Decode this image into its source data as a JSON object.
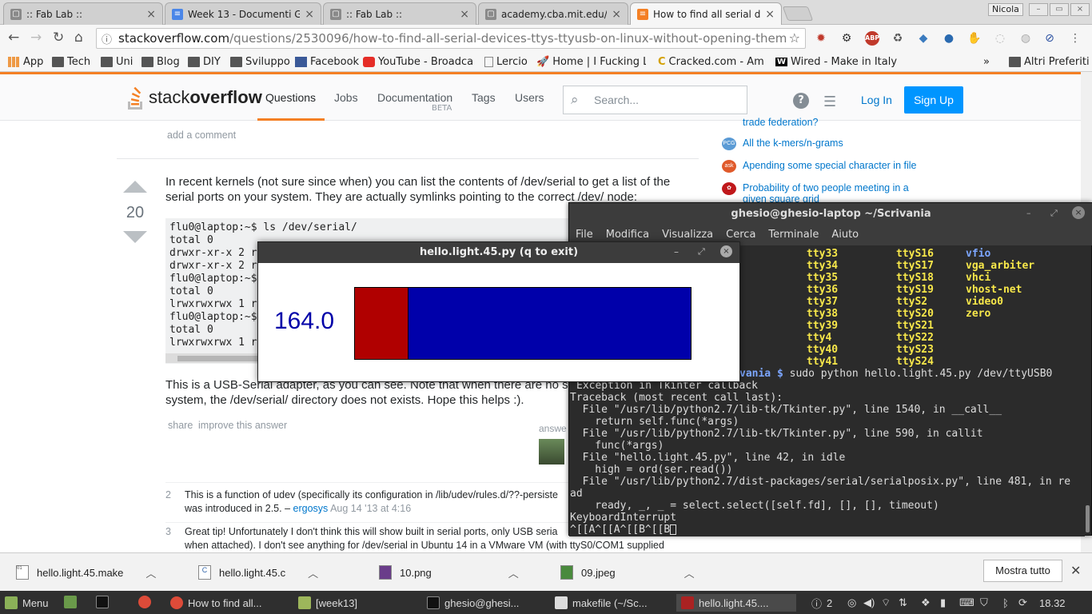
{
  "browser": {
    "tabs": [
      {
        "title": ":: Fab Lab ::",
        "icon_color": "#8a8a8a"
      },
      {
        "title": "Week 13 - Documenti G",
        "icon_color": "#4a86e8"
      },
      {
        "title": ":: Fab Lab ::",
        "icon_color": "#8a8a8a"
      },
      {
        "title": "academy.cba.mit.edu/cl",
        "icon_color": "#8a8a8a"
      },
      {
        "title": "How to find all serial de",
        "icon_color": "#f48024"
      }
    ],
    "user": "Nicola",
    "url_host": "stackoverflow.com",
    "url_path": "/questions/2530096/how-to-find-all-serial-devices-ttys-ttyusb-on-linux-without-opening-them",
    "bookmarks": [
      {
        "label": "App",
        "icon": "apps-icon"
      },
      {
        "label": "Tech",
        "icon": "folder-icon"
      },
      {
        "label": "Uni",
        "icon": "folder-icon"
      },
      {
        "label": "Blog",
        "icon": "folder-icon"
      },
      {
        "label": "DIY",
        "icon": "folder-icon"
      },
      {
        "label": "Sviluppo",
        "icon": "folder-icon"
      },
      {
        "label": "Facebook",
        "icon": "facebook-icon"
      },
      {
        "label": "YouTube - Broadcast",
        "icon": "youtube-icon"
      },
      {
        "label": "Lercio",
        "icon": "page-icon"
      },
      {
        "label": "Home | I Fucking Lo",
        "icon": "rocket-icon"
      },
      {
        "label": "Cracked.com - Amer",
        "icon": "cracked-icon"
      },
      {
        "label": "Wired - Make in Italy",
        "icon": "wired-icon"
      }
    ],
    "bookmarks_more": "»",
    "other_bookmarks": "Altri Preferiti"
  },
  "so": {
    "logo_light": "stack",
    "logo_bold": "overflow",
    "nav": [
      "Questions",
      "Jobs",
      "Documentation",
      "Tags",
      "Users"
    ],
    "beta": "BETA",
    "search_placeholder": "Search...",
    "login": "Log In",
    "signup": "Sign Up",
    "add_comment": "add a comment",
    "sidebar": [
      {
        "text": "trade federation?",
        "icon_color": "#7a4fa8"
      },
      {
        "text": "All the k-mers/n-grams",
        "icon_color": "#5b9bd5"
      },
      {
        "text": "Apending some special character in file",
        "icon_color": "#e05a2b"
      },
      {
        "text": "Probability of two people meeting in a given square grid",
        "icon_color": "#c0181b"
      }
    ],
    "votes": "20",
    "answer_p1": "In recent kernels (not sure since when) you can list the contents of /dev/serial to get a list of the serial ports on your system. They are actually symlinks pointing to the correct /dev/ node:",
    "code_lines": [
      "flu0@laptop:~$ ls /dev/serial/",
      "total 0",
      "drwxr-xr-x 2 r",
      "drwxr-xr-x 2 r",
      "flu0@laptop:~$",
      "total 0",
      "lrwxrwxrwx 1 r",
      "flu0@laptop:~$",
      "total 0",
      "lrwxrwxrwx 1 r"
    ],
    "answer_p2": "This is a USB-Serial adapter, as you can see. Note that when there are no s",
    "answer_p3": "system, the /dev/serial/ directory does not exists. Hope this helps :).",
    "share": "share",
    "improve": "improve this answer",
    "answered": "answe",
    "comments": [
      {
        "num": "2",
        "text": "This is a function of udev (specifically its configuration in /lib/udev/rules.d/??-persiste",
        "text2": "was introduced in 2.5. –",
        "user": "ergosys",
        "date": "Aug 14 '13 at 4:16"
      },
      {
        "num": "3",
        "text": "Great tip! Unfortunately I don't think this will show built in serial ports, only USB seria",
        "text2": "when attached). I don't see anything for /dev/serial in Ubuntu 14 in a VMware VM (with ttyS0/COM1 supplied",
        "user": "",
        "date": ""
      }
    ]
  },
  "terminal": {
    "title": "ghesio@ghesio-laptop ~/Scrivania",
    "menu": [
      "File",
      "Modifica",
      "Visualizza",
      "Cerca",
      "Terminale",
      "Aiuto"
    ],
    "col1": [
      "tty33",
      "tty34",
      "tty35",
      "tty36",
      "tty37",
      "tty38",
      "tty39",
      "tty4",
      "tty40",
      "tty41"
    ],
    "col2": [
      "ttyS16",
      "ttyS17",
      "ttyS18",
      "ttyS19",
      "ttyS2",
      "ttyS20",
      "ttyS21",
      "ttyS22",
      "ttyS23",
      "ttyS24"
    ],
    "col3": [
      "vfio",
      "vga_arbiter",
      "vhci",
      "vhost-net",
      "video0",
      "zero"
    ],
    "prompt_tail": "vania $",
    "command": " sudo python hello.light.45.py /dev/ttyUSB0",
    "output": [
      "Exception in Tkinter callback",
      "Traceback (most recent call last):",
      "  File \"/usr/lib/python2.7/lib-tk/Tkinter.py\", line 1540, in __call__",
      "    return self.func(*args)",
      "  File \"/usr/lib/python2.7/lib-tk/Tkinter.py\", line 590, in callit",
      "    func(*args)",
      "  File \"hello.light.45.py\", line 42, in idle",
      "    high = ord(ser.read())",
      "  File \"/usr/lib/python2.7/dist-packages/serial/serialposix.py\", line 481, in re",
      "ad",
      "    ready, _, _ = select.select([self.fd], [], [], timeout)",
      "KeyboardInterrupt",
      "^[[A^[[A^[[B^[[B"
    ]
  },
  "hello": {
    "title": "hello.light.45.py (q to exit)",
    "value": "164.0",
    "level_fraction": 0.16,
    "bar_color_low": "#b00000",
    "bar_color_high": "#0000aa"
  },
  "downloads": {
    "items": [
      {
        "name": "hello.light.45.make"
      },
      {
        "name": "hello.light.45.c"
      },
      {
        "name": "10.png"
      },
      {
        "name": "09.jpeg"
      }
    ],
    "show_all": "Mostra tutto"
  },
  "taskbar": {
    "menu": "Menu",
    "items": [
      "How to find all...",
      "[week13]",
      "ghesio@ghesi...",
      "makefile (~/Sc...",
      "hello.light.45...."
    ],
    "notif_count": "2",
    "clock": "18.32"
  }
}
